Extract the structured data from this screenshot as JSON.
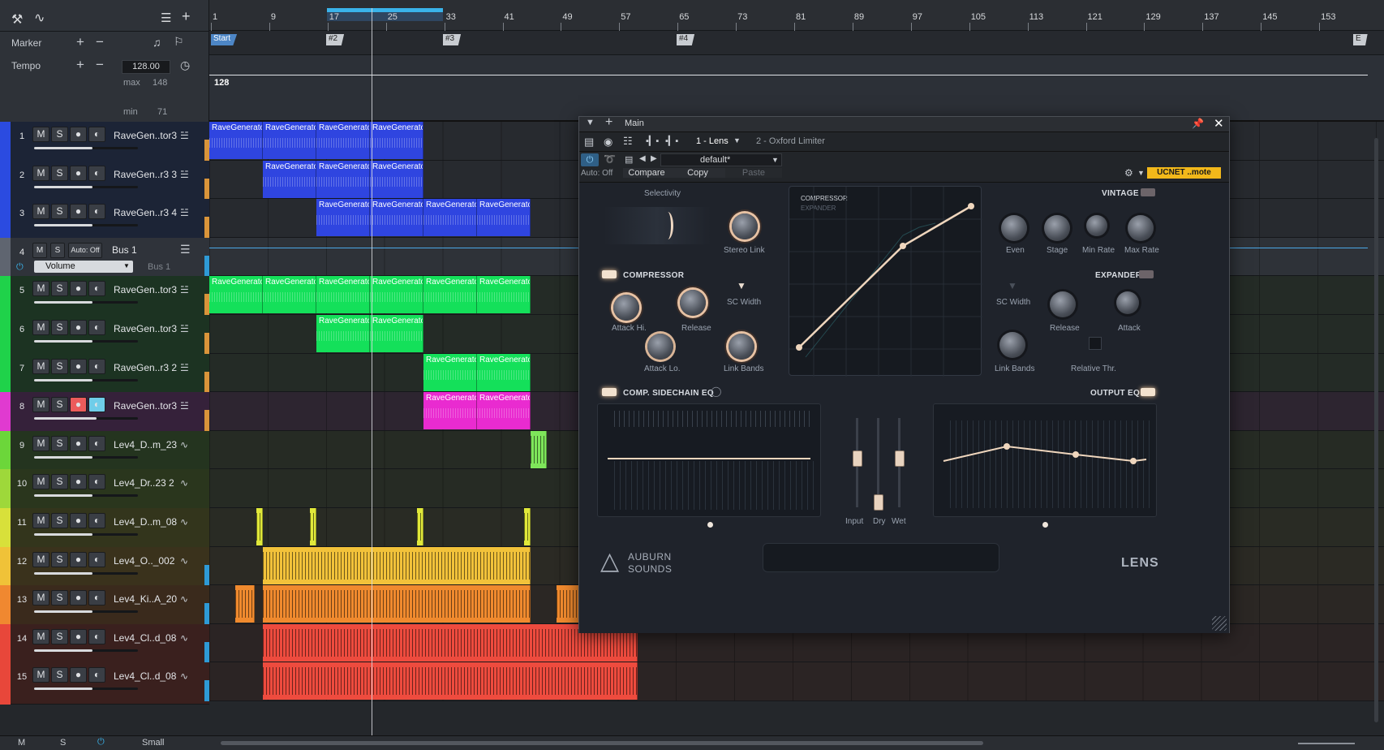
{
  "global": {
    "marker_label": "Marker",
    "tempo_label": "Tempo",
    "tempo_value": "128.00",
    "max_label": "max",
    "max_value": "148",
    "min_label": "min",
    "min_value": "71",
    "tempo_lane_value": "128"
  },
  "ruler": [
    "1",
    "9",
    "17",
    "25",
    "33",
    "41",
    "49",
    "57",
    "65",
    "73",
    "81",
    "89",
    "97",
    "105",
    "113",
    "121",
    "129",
    "137",
    "145",
    "153"
  ],
  "markers": [
    "Start",
    "#2",
    "#3",
    "#4",
    "E"
  ],
  "tracks": [
    {
      "num": "1",
      "name": "RaveGen..tor3",
      "clips": [
        "RaveGenerato",
        "RaveGenerato",
        "RaveGenerato",
        "RaveGenerato"
      ]
    },
    {
      "num": "2",
      "name": "RaveGen..r3 3",
      "clips": [
        "RaveGenerato",
        "RaveGenerato",
        "RaveGenerato"
      ]
    },
    {
      "num": "3",
      "name": "RaveGen..r3 4",
      "clips": [
        "RaveGenerato",
        "RaveGenerato",
        "RaveGenerato",
        "RaveGenerato"
      ]
    },
    {
      "num": "4",
      "name": "Bus 1",
      "auto": "Auto: Off",
      "param": "Volume",
      "bus": "Bus 1"
    },
    {
      "num": "5",
      "name": "RaveGen..tor3",
      "clips": [
        "RaveGenerato",
        "RaveGenerato",
        "RaveGenerato",
        "RaveGenerato",
        "RaveGenerato",
        "RaveGenerato"
      ]
    },
    {
      "num": "6",
      "name": "RaveGen..tor3",
      "clips": [
        "RaveGenerato",
        "RaveGenerato"
      ]
    },
    {
      "num": "7",
      "name": "RaveGen..r3 2",
      "clips": [
        "RaveGenerato",
        "RaveGenerato"
      ]
    },
    {
      "num": "8",
      "name": "RaveGen..tor3",
      "clips": [
        "RaveGenerato",
        "RaveGenerato"
      ]
    },
    {
      "num": "9",
      "name": "Lev4_D..m_23"
    },
    {
      "num": "10",
      "name": "Lev4_Dr..23 2"
    },
    {
      "num": "11",
      "name": "Lev4_D..m_08"
    },
    {
      "num": "12",
      "name": "Lev4_O.._002"
    },
    {
      "num": "13",
      "name": "Lev4_Ki..A_20"
    },
    {
      "num": "14",
      "name": "Lev4_Cl..d_08"
    },
    {
      "num": "15",
      "name": "Lev4_Cl..d_08"
    }
  ],
  "buttons": {
    "mute": "M",
    "solo": "S"
  },
  "bottom": {
    "m": "M",
    "s": "S",
    "size": "Small"
  },
  "plugin": {
    "title": "Main",
    "slot1": "1 - Lens",
    "slot2": "2 - Oxford Limiter",
    "preset": "default*",
    "auto_off": "Auto: Off",
    "compare": "Compare",
    "copy": "Copy",
    "paste": "Paste",
    "remote": "UCNET ..mote",
    "selectivity": "Selectivity",
    "stereo_link": "Stereo Link",
    "compressor": "COMPRESSOR",
    "compressor_small": "COMPRESSOR",
    "expander_small": "EXPANDER",
    "vintage": "VINTAGE",
    "even": "Even",
    "stage": "Stage",
    "min_rate": "Min Rate",
    "max_rate": "Max Rate",
    "attack_hi": "Attack Hi.",
    "release": "Release",
    "sc_width": "SC Width",
    "attack_lo": "Attack Lo.",
    "link_bands": "Link Bands",
    "expander": "EXPANDER",
    "exp_sc_width": "SC Width",
    "exp_release": "Release",
    "exp_attack": "Attack",
    "exp_link_bands": "Link Bands",
    "relative_thr": "Relative Thr.",
    "comp_sidechain_eq": "COMP. SIDECHAIN EQ",
    "output_eq": "OUTPUT EQ",
    "input": "Input",
    "dry": "Dry",
    "wet": "Wet",
    "brand_line1": "AUBURN",
    "brand_line2": "SOUNDS",
    "product": "LENS"
  }
}
